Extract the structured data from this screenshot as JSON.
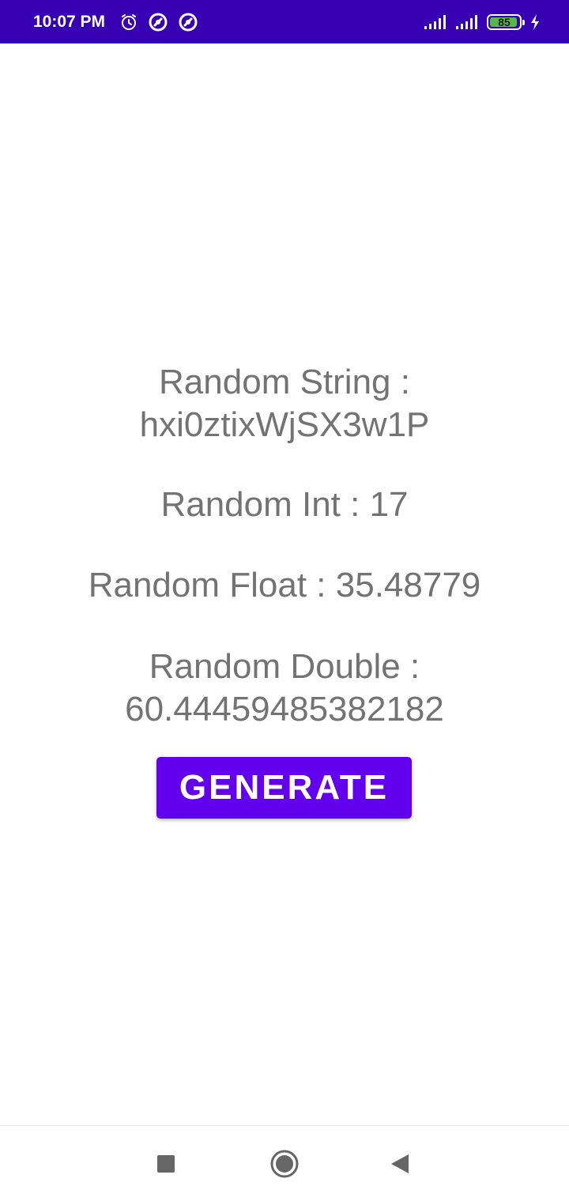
{
  "status_bar": {
    "time": "10:07 PM",
    "battery_level": "85",
    "background_color": "#3700b3",
    "left_icons": [
      "alarm-icon",
      "notification-circle-icon",
      "notification-circle-icon"
    ],
    "right_icons": [
      "signal-icon",
      "signal-icon",
      "battery-icon",
      "charging-icon"
    ]
  },
  "main": {
    "random_string": {
      "label": "Random String :",
      "value": "hxi0ztixWjSX3w1P"
    },
    "random_int": "Random Int : 17",
    "random_float": "Random Float : 35.48779",
    "random_double": {
      "label": "Random Double :",
      "value": "60.44459485382182"
    },
    "generate_button": "GENERATE",
    "accent_color": "#6200ee",
    "text_color": "#737373"
  },
  "nav_bar": {
    "buttons": [
      "recent-apps-icon",
      "home-icon",
      "back-icon"
    ]
  }
}
